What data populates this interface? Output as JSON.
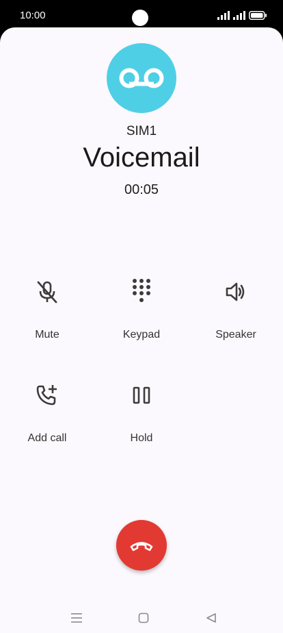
{
  "status_bar": {
    "time": "10:00"
  },
  "call": {
    "sim": "SIM1",
    "name": "Voicemail",
    "timer": "00:05"
  },
  "controls": [
    {
      "label": "Mute",
      "icon": "mic-off-icon"
    },
    {
      "label": "Keypad",
      "icon": "dialpad-icon"
    },
    {
      "label": "Speaker",
      "icon": "speaker-icon"
    },
    {
      "label": "Add call",
      "icon": "add-call-icon"
    },
    {
      "label": "Hold",
      "icon": "pause-icon"
    }
  ],
  "colors": {
    "avatar": "#4fcfe6",
    "end_call": "#e23a32",
    "background": "#fbf9fd"
  },
  "nav_bar": {
    "icons": [
      "menu-icon",
      "home-icon",
      "back-icon"
    ]
  }
}
